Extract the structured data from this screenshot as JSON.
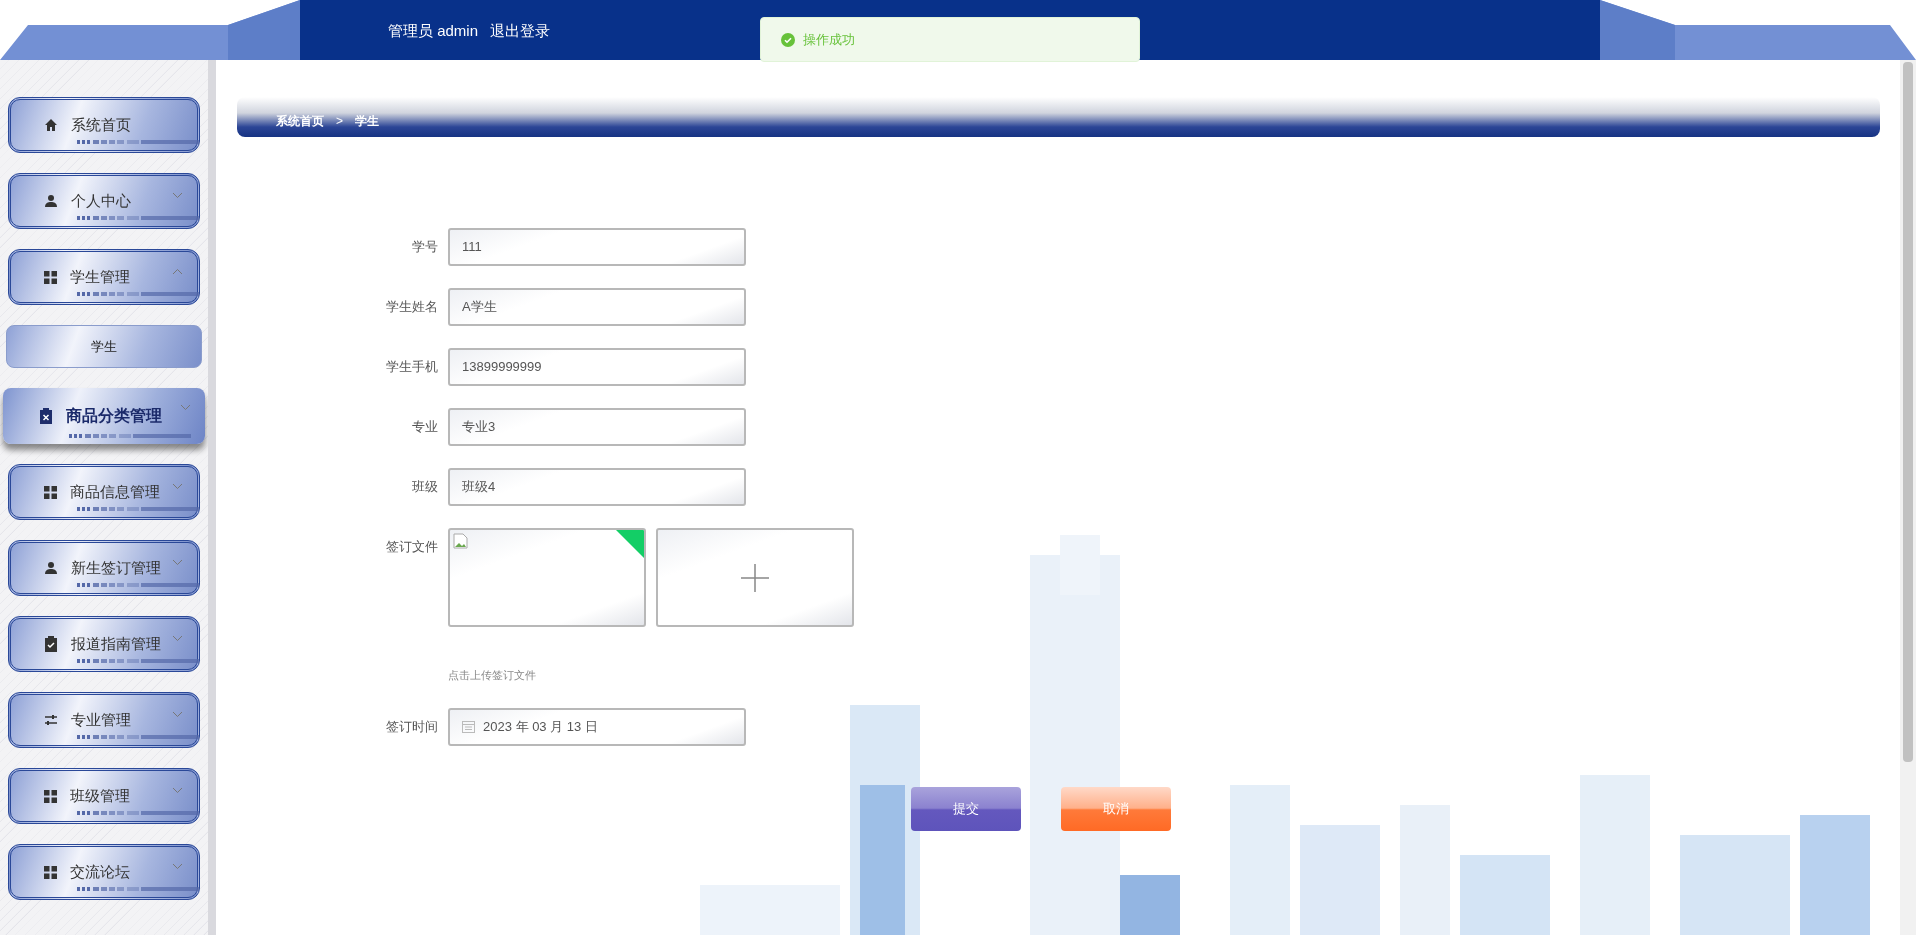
{
  "header": {
    "user_label": "管理员 admin",
    "logout": "退出登录"
  },
  "toast": {
    "message": "操作成功"
  },
  "sidebar": {
    "items": [
      {
        "label": "系统首页",
        "kind": "link",
        "hovered": false
      },
      {
        "label": "个人中心",
        "kind": "menu",
        "expanded": false,
        "hovered": false
      },
      {
        "label": "学生管理",
        "kind": "menu",
        "expanded": true,
        "hovered": false,
        "children": [
          {
            "label": "学生"
          }
        ]
      },
      {
        "label": "商品分类管理",
        "kind": "menu",
        "expanded": false,
        "hovered": true
      },
      {
        "label": "商品信息管理",
        "kind": "menu",
        "expanded": false,
        "hovered": false
      },
      {
        "label": "新生签订管理",
        "kind": "menu",
        "expanded": false,
        "hovered": false
      },
      {
        "label": "报道指南管理",
        "kind": "menu",
        "expanded": false,
        "hovered": false
      },
      {
        "label": "专业管理",
        "kind": "menu",
        "expanded": false,
        "hovered": false
      },
      {
        "label": "班级管理",
        "kind": "menu",
        "expanded": false,
        "hovered": false
      },
      {
        "label": "交流论坛",
        "kind": "menu",
        "expanded": false,
        "hovered": false
      }
    ]
  },
  "breadcrumb": [
    "系统首页",
    "学生"
  ],
  "breadcrumb_separator": ">",
  "form": {
    "fields": [
      {
        "kind": "text",
        "label": "学号",
        "value": "111"
      },
      {
        "kind": "text",
        "label": "学生姓名",
        "value": "A学生"
      },
      {
        "kind": "text",
        "label": "学生手机",
        "value": "13899999999"
      },
      {
        "kind": "text",
        "label": "专业",
        "value": "专业3"
      },
      {
        "kind": "text",
        "label": "班级",
        "value": "班级4"
      },
      {
        "kind": "upload",
        "label": "签订文件",
        "uploaded": true,
        "hint": "点击上传签订文件"
      },
      {
        "kind": "date",
        "label": "签订时间",
        "value": "2023 年 03 月 13 日"
      }
    ],
    "buttons": [
      {
        "kind": "submit",
        "label": "提交"
      },
      {
        "kind": "cancel",
        "label": "取消"
      }
    ]
  }
}
